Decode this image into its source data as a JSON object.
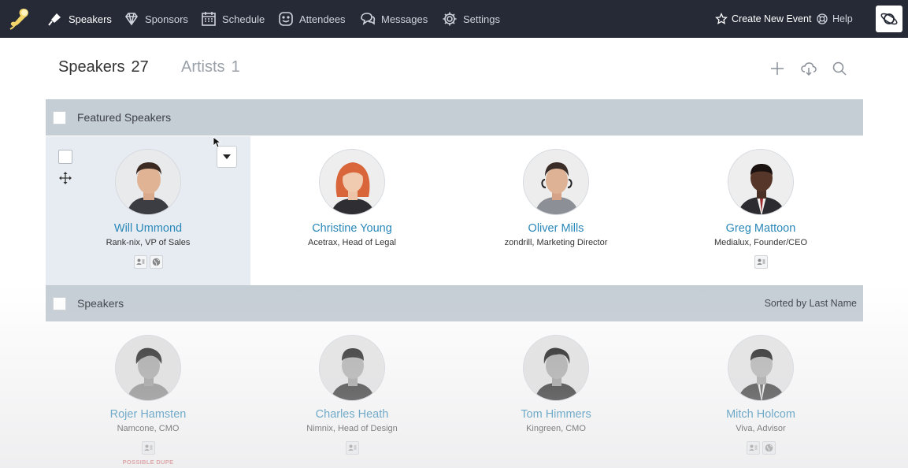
{
  "nav": {
    "items": [
      {
        "label": "Speakers",
        "icon": "microphone-icon"
      },
      {
        "label": "Sponsors",
        "icon": "diamond-icon"
      },
      {
        "label": "Schedule",
        "icon": "calendar-icon"
      },
      {
        "label": "Attendees",
        "icon": "smiley-icon"
      },
      {
        "label": "Messages",
        "icon": "chat-icon"
      },
      {
        "label": "Settings",
        "icon": "gear-icon"
      }
    ],
    "create_event": "Create New Event",
    "help": "Help"
  },
  "tabs": [
    {
      "label": "Speakers",
      "count": "27"
    },
    {
      "label": "Artists",
      "count": "1"
    }
  ],
  "featured": {
    "title": "Featured Speakers",
    "speakers": [
      {
        "name": "Will Ummond",
        "role": "Rank-nix, VP of Sales"
      },
      {
        "name": "Christine Young",
        "role": "Acetrax, Head of Legal"
      },
      {
        "name": "Oliver Mills",
        "role": "zondrill, Marketing Director"
      },
      {
        "name": "Greg Mattoon",
        "role": "Medialux, Founder/CEO"
      }
    ]
  },
  "speakers": {
    "title": "Speakers",
    "sort_label": "Sorted by Last Name",
    "list": [
      {
        "name": "Rojer Hamsten",
        "role": "Namcone, CMO",
        "flag": "POSSIBLE DUPE"
      },
      {
        "name": "Charles Heath",
        "role": "Nimnix, Head of Design"
      },
      {
        "name": "Tom Himmers",
        "role": "Kingreen, CMO"
      },
      {
        "name": "Mitch Holcom",
        "role": "Viva, Advisor"
      }
    ]
  },
  "colors": {
    "topbar": "#262a36",
    "section_bar": "#c5cdd5",
    "name_link": "#2a88b8",
    "selected_card": "#e7ecf3",
    "dupe_flag": "#d9686a"
  }
}
